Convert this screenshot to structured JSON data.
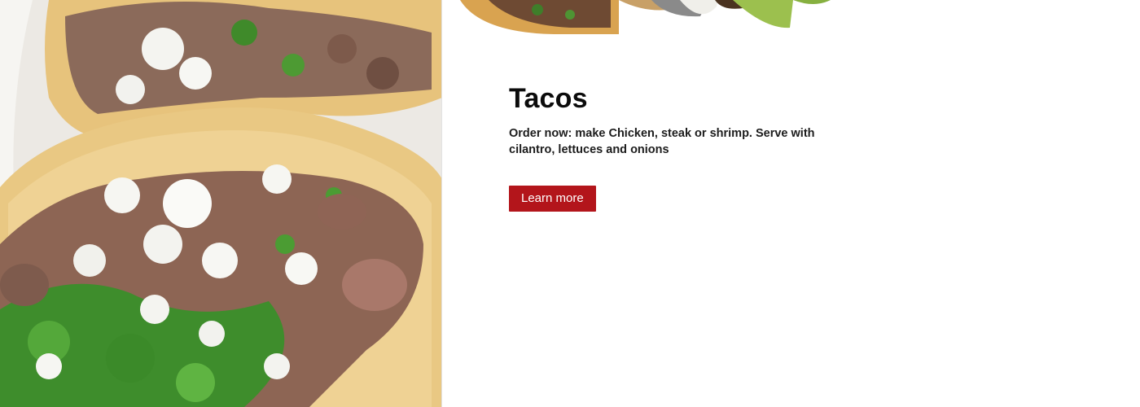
{
  "hero": {
    "title": "Tacos",
    "description": "Order now: make Chicken, steak or shrimp. Serve with cilantro, lettuces and onions",
    "cta_label": "Learn more"
  },
  "images": {
    "main_photo": "tacos-photo",
    "top_strip": "tacos-strip-photo"
  },
  "colors": {
    "cta_background": "#b3151b",
    "cta_text": "#ffffff",
    "title": "#0b0b0b",
    "background": "#ffffff"
  }
}
